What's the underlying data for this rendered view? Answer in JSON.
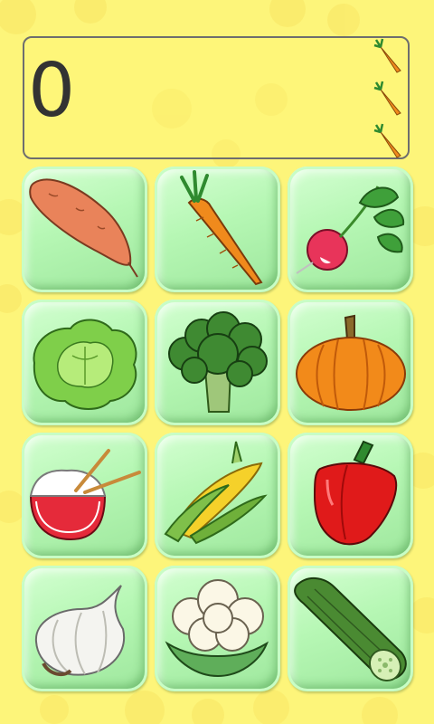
{
  "score": {
    "value": "0"
  },
  "lives": {
    "count": 3,
    "icon": "carrot-icon"
  },
  "tiles": [
    {
      "name": "sweet-potato",
      "icon": "sweet-potato-icon"
    },
    {
      "name": "carrot",
      "icon": "carrot-icon"
    },
    {
      "name": "radish",
      "icon": "radish-icon"
    },
    {
      "name": "lettuce",
      "icon": "lettuce-icon"
    },
    {
      "name": "broccoli",
      "icon": "broccoli-icon"
    },
    {
      "name": "pumpkin",
      "icon": "pumpkin-icon"
    },
    {
      "name": "rice-bowl",
      "icon": "rice-bowl-icon"
    },
    {
      "name": "corn",
      "icon": "corn-icon"
    },
    {
      "name": "red-pepper",
      "icon": "red-pepper-icon"
    },
    {
      "name": "garlic",
      "icon": "garlic-icon"
    },
    {
      "name": "cauliflower",
      "icon": "cauliflower-icon"
    },
    {
      "name": "cucumber",
      "icon": "cucumber-icon"
    }
  ],
  "colors": {
    "background": "#fdf57a",
    "tile": "#b6f7b4",
    "score_text": "#333333",
    "panel_border": "#6e6e6e"
  }
}
